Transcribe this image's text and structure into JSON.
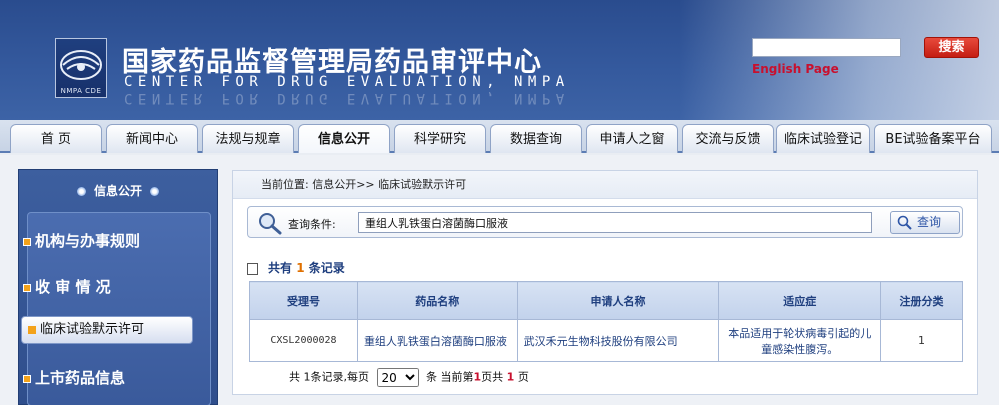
{
  "header": {
    "title_cn": "国家药品监督管理局药品审评中心",
    "title_en": "CENTER FOR DRUG EVALUATION, NMPA",
    "logo_text": "NMPA CDE",
    "search_button": "搜索",
    "search_value": "",
    "english_link": "English Page"
  },
  "nav": {
    "tabs": [
      {
        "label": "首 页"
      },
      {
        "label": "新闻中心"
      },
      {
        "label": "法规与规章"
      },
      {
        "label": "信息公开",
        "active": true
      },
      {
        "label": "科学研究"
      },
      {
        "label": "数据查询"
      },
      {
        "label": "申请人之窗"
      },
      {
        "label": "交流与反馈"
      },
      {
        "label": "临床试验登记"
      },
      {
        "label": "BE试验备案平台"
      }
    ]
  },
  "sidebar": {
    "title": "信息公开",
    "items": [
      {
        "label": "机构与办事规则"
      },
      {
        "label": "收 审 情 况"
      },
      {
        "label": "临床试验默示许可",
        "active": true
      },
      {
        "label": "上市药品信息"
      }
    ]
  },
  "content": {
    "breadcrumb": "当前位置: 信息公开>> 临床试验默示许可",
    "query_label": "查询条件:",
    "query_value": "重组人乳铁蛋白溶菌酶口服液",
    "query_button": "查询",
    "records_prefix": "共有",
    "records_count": "1",
    "records_suffix": "条记录",
    "table": {
      "headers": [
        "受理号",
        "药品名称",
        "申请人名称",
        "适应症",
        "注册分类"
      ],
      "rows": [
        [
          "CXSL2000028",
          "重组人乳铁蛋白溶菌酶口服液",
          "武汉禾元生物科技股份有限公司",
          "本品适用于轮状病毒引起的儿童感染性腹泻。",
          "1"
        ]
      ]
    },
    "pager": {
      "total_text": "共 1条记录,每页",
      "page_size": "20",
      "mid_text": "条 当前第",
      "current_page": "1",
      "of_text": "页共",
      "total_pages": "1",
      "end_text": "页"
    }
  },
  "colors": {
    "header_blue": "#2a4c8e",
    "accent_red": "#c8102e",
    "link_blue": "#1f3f7f",
    "count_orange": "#e07000"
  }
}
